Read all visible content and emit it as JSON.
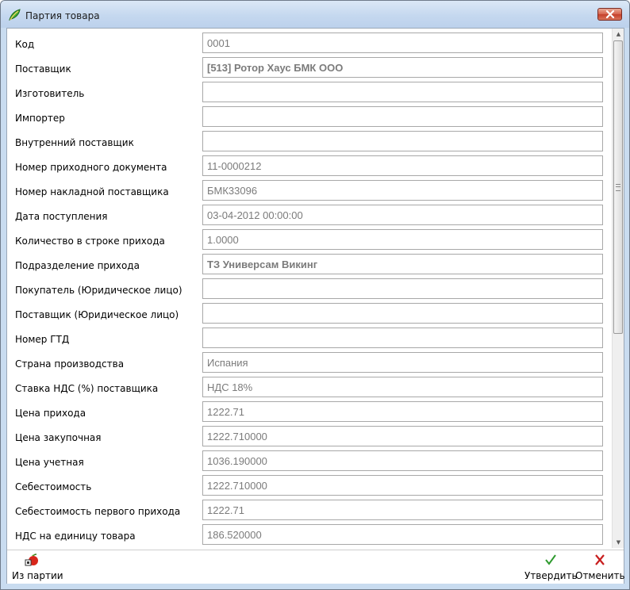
{
  "window": {
    "title": "Партия товара"
  },
  "fields": [
    {
      "label": "Код",
      "value": "0001",
      "bold": false
    },
    {
      "label": "Поставщик",
      "value": "[513] Ротор Хаус БМК ООО",
      "bold": true
    },
    {
      "label": "Изготовитель",
      "value": "",
      "bold": false
    },
    {
      "label": "Импортер",
      "value": "",
      "bold": false
    },
    {
      "label": "Внутренний поставщик",
      "value": "",
      "bold": false
    },
    {
      "label": "Номер приходного документа",
      "value": "11-0000212",
      "bold": false
    },
    {
      "label": "Номер накладной поставщика",
      "value": "БМК33096",
      "bold": false
    },
    {
      "label": "Дата поступления",
      "value": "03-04-2012 00:00:00",
      "bold": false
    },
    {
      "label": "Количество в строке прихода",
      "value": "1.0000",
      "bold": false
    },
    {
      "label": "Подразделение прихода",
      "value": "ТЗ Универсам Викинг",
      "bold": true
    },
    {
      "label": "Покупатель (Юридическое лицо)",
      "value": "",
      "bold": false
    },
    {
      "label": "Поставщик (Юридическое лицо)",
      "value": "",
      "bold": false
    },
    {
      "label": "Номер ГТД",
      "value": "",
      "bold": false
    },
    {
      "label": "Страна производства",
      "value": "Испания",
      "bold": false
    },
    {
      "label": "Ставка НДС (%) поставщика",
      "value": "НДС 18%",
      "bold": false
    },
    {
      "label": "Цена прихода",
      "value": "1222.71",
      "bold": false
    },
    {
      "label": "Цена закупочная",
      "value": "1222.710000",
      "bold": false
    },
    {
      "label": "Цена учетная",
      "value": "1036.190000",
      "bold": false
    },
    {
      "label": "Себестоимость",
      "value": "1222.710000",
      "bold": false
    },
    {
      "label": "Себестоимость первого прихода",
      "value": "1222.71",
      "bold": false
    },
    {
      "label": "НДС на единицу товара",
      "value": "186.520000",
      "bold": false
    }
  ],
  "toolbar": {
    "from_batch_label": "Из партии",
    "confirm_label": "Утвердить",
    "cancel_label": "Отменить"
  },
  "icons": {
    "app": "app-leaf-icon",
    "close": "close-icon",
    "from_batch": "apple-copy-icon",
    "confirm": "green-check-icon",
    "cancel": "red-cross-icon"
  },
  "colors": {
    "field_text": "#7b7b7b",
    "confirm_icon": "#2e9a2e",
    "cancel_icon": "#c81e1e",
    "close_button": "#c5402b"
  },
  "scroll": {
    "position_fraction": 0.0,
    "visible_fraction": 0.58
  }
}
